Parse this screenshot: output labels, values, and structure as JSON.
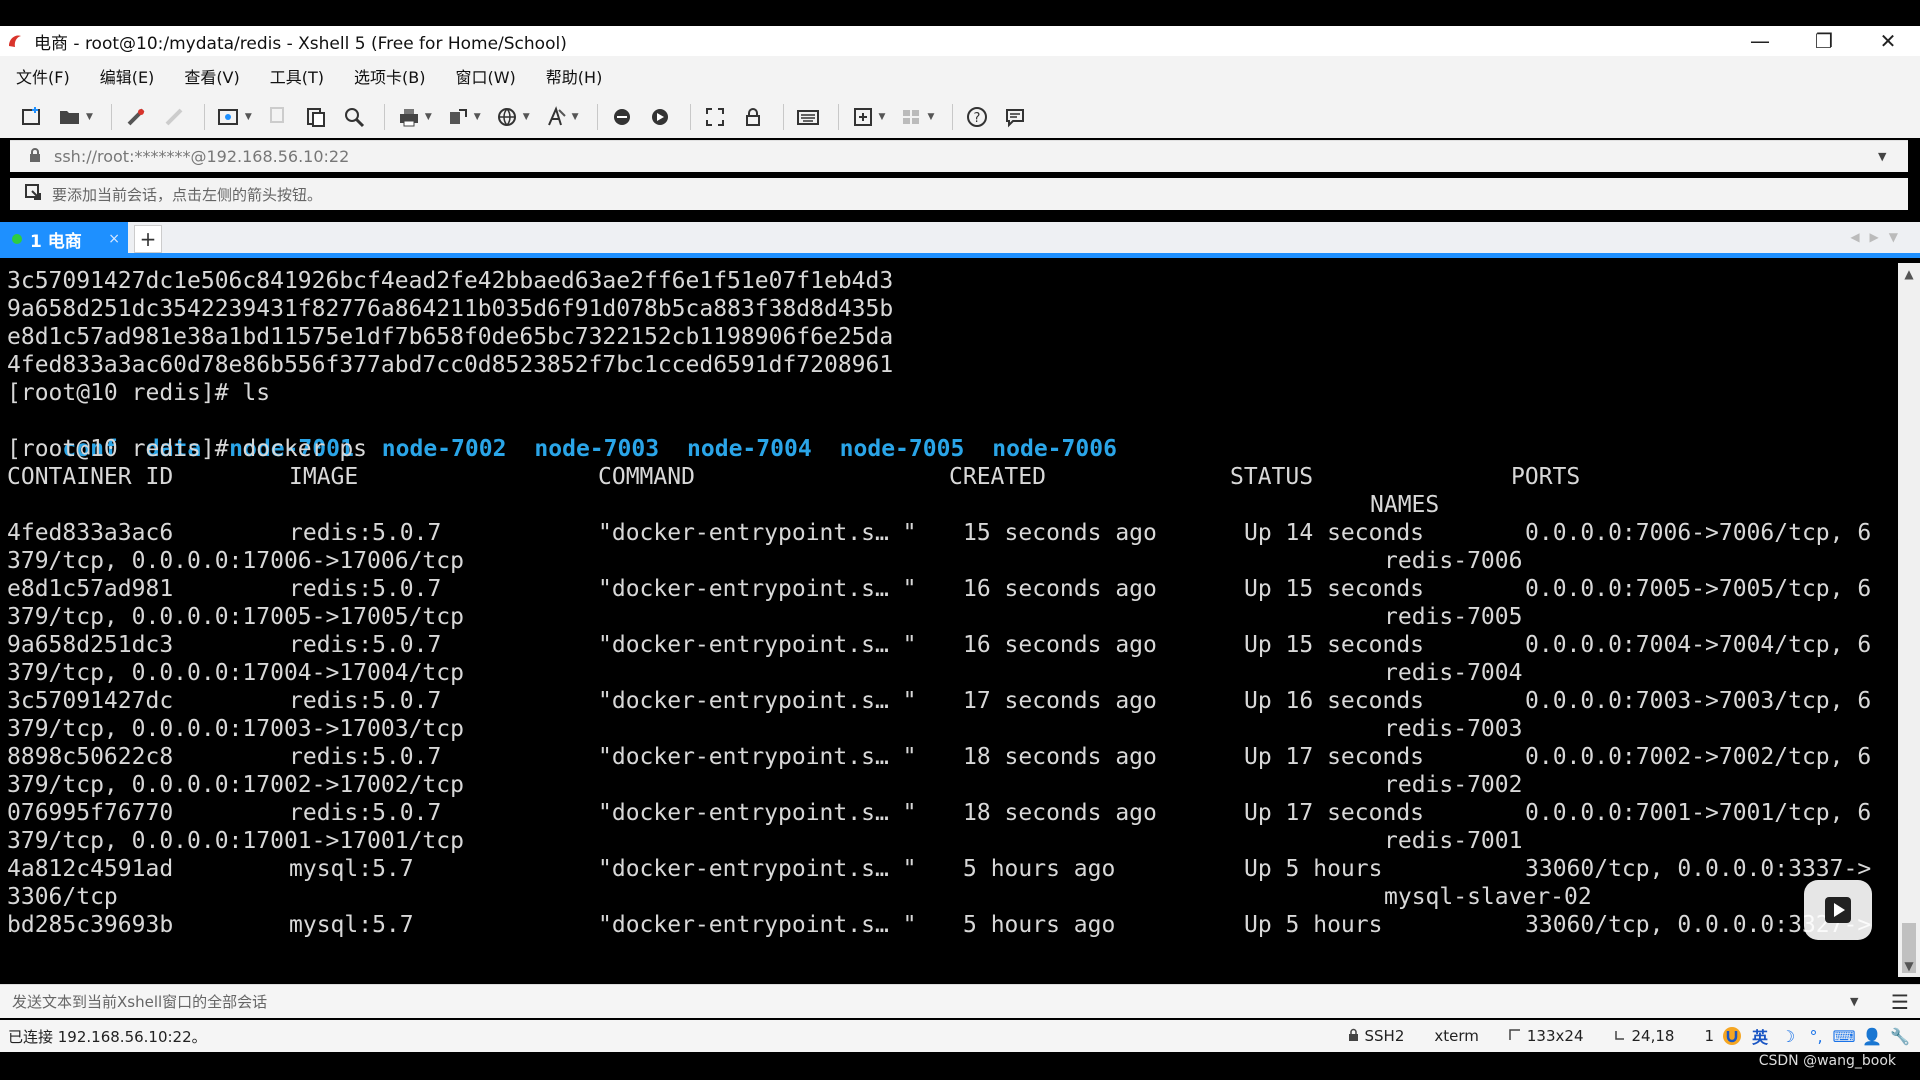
{
  "window": {
    "title": "电商 - root@10:/mydata/redis - Xshell 5 (Free for Home/School)",
    "minimize": "—",
    "restore": "❐",
    "close": "✕"
  },
  "menu": {
    "items": [
      "文件(F)",
      "编辑(E)",
      "查看(V)",
      "工具(T)",
      "选项卡(B)",
      "窗口(W)",
      "帮助(H)"
    ]
  },
  "address": {
    "value": "ssh://root:*******@192.168.56.10:22"
  },
  "hint": {
    "text": "要添加当前会话，点击左侧的箭头按钮。"
  },
  "tab": {
    "label": "1 电商",
    "close": "×",
    "add": "+"
  },
  "terminal": {
    "hash_lines": [
      "3c57091427dc1e506c841926bcf4ead2fe42bbaed63ae2ff6e1f51e07f1eb4d3",
      "9a658d251dc3542239431f82776a864211b035d6f91d078b5ca883f38d8d435b",
      "e8d1c57ad981e38a1bd11575e1df7b658f0de65bc7322152cb1198906f6e25da",
      "4fed833a3ac60d78e86b556f377abd7cc0d8523852f7bc1cced6591df7208961"
    ],
    "prompt_ls": "[root@10 redis]# ls",
    "ls_items": [
      "conf",
      "data",
      "node-7001",
      "node-7002",
      "node-7003",
      "node-7004",
      "node-7005",
      "node-7006"
    ],
    "prompt_docker": "[root@10 redis]# docker ps",
    "headers": {
      "container_id": "CONTAINER ID",
      "image": "IMAGE",
      "command": "COMMAND",
      "created": "CREATED",
      "status": "STATUS",
      "ports": "PORTS",
      "names": "NAMES"
    },
    "containers": [
      {
        "id": "4fed833a3ac6",
        "image": "redis:5.0.7",
        "command": "\"docker-entrypoint.s… \"",
        "created": "15 seconds ago",
        "status": "Up 14 seconds",
        "ports": "0.0.0.0:7006->7006/tcp, 6",
        "ports_wrap": "379/tcp, 0.0.0.0:17006->17006/tcp",
        "name": "redis-7006"
      },
      {
        "id": "e8d1c57ad981",
        "image": "redis:5.0.7",
        "command": "\"docker-entrypoint.s… \"",
        "created": "16 seconds ago",
        "status": "Up 15 seconds",
        "ports": "0.0.0.0:7005->7005/tcp, 6",
        "ports_wrap": "379/tcp, 0.0.0.0:17005->17005/tcp",
        "name": "redis-7005"
      },
      {
        "id": "9a658d251dc3",
        "image": "redis:5.0.7",
        "command": "\"docker-entrypoint.s… \"",
        "created": "16 seconds ago",
        "status": "Up 15 seconds",
        "ports": "0.0.0.0:7004->7004/tcp, 6",
        "ports_wrap": "379/tcp, 0.0.0.0:17004->17004/tcp",
        "name": "redis-7004"
      },
      {
        "id": "3c57091427dc",
        "image": "redis:5.0.7",
        "command": "\"docker-entrypoint.s… \"",
        "created": "17 seconds ago",
        "status": "Up 16 seconds",
        "ports": "0.0.0.0:7003->7003/tcp, 6",
        "ports_wrap": "379/tcp, 0.0.0.0:17003->17003/tcp",
        "name": "redis-7003"
      },
      {
        "id": "8898c50622c8",
        "image": "redis:5.0.7",
        "command": "\"docker-entrypoint.s… \"",
        "created": "18 seconds ago",
        "status": "Up 17 seconds",
        "ports": "0.0.0.0:7002->7002/tcp, 6",
        "ports_wrap": "379/tcp, 0.0.0.0:17002->17002/tcp",
        "name": "redis-7002"
      },
      {
        "id": "076995f76770",
        "image": "redis:5.0.7",
        "command": "\"docker-entrypoint.s… \"",
        "created": "18 seconds ago",
        "status": "Up 17 seconds",
        "ports": "0.0.0.0:7001->7001/tcp, 6",
        "ports_wrap": "379/tcp, 0.0.0.0:17001->17001/tcp",
        "name": "redis-7001"
      },
      {
        "id": "4a812c4591ad",
        "image": "mysql:5.7",
        "command": "\"docker-entrypoint.s… \"",
        "created": "5 hours ago",
        "status": "Up 5 hours",
        "ports": "33060/tcp, 0.0.0.0:3337->",
        "ports_wrap": "3306/tcp",
        "name": "mysql-slaver-02"
      },
      {
        "id": "bd285c39693b",
        "image": "mysql:5.7",
        "command": "\"docker-entrypoint.s… \"",
        "created": "5 hours ago",
        "status": "Up 5 hours",
        "ports": "33060/tcp, 0.0.0.0:3327->",
        "ports_wrap": "",
        "name": ""
      }
    ]
  },
  "sendbar": {
    "placeholder": "发送文本到当前Xshell窗口的全部会话"
  },
  "status": {
    "connection": "已连接 192.168.56.10:22。",
    "protocol": "SSH2",
    "terminal_type": "xterm",
    "size": "133x24",
    "cursor": "24,18",
    "sessions": "1",
    "ime_lang": "英"
  },
  "watermark": "CSDN @wang_book",
  "colors": {
    "accent": "#1e90ff",
    "ls_dir": "#2aa5e8",
    "terminal_fg": "#d8d8d8",
    "terminal_bg": "#000000"
  }
}
